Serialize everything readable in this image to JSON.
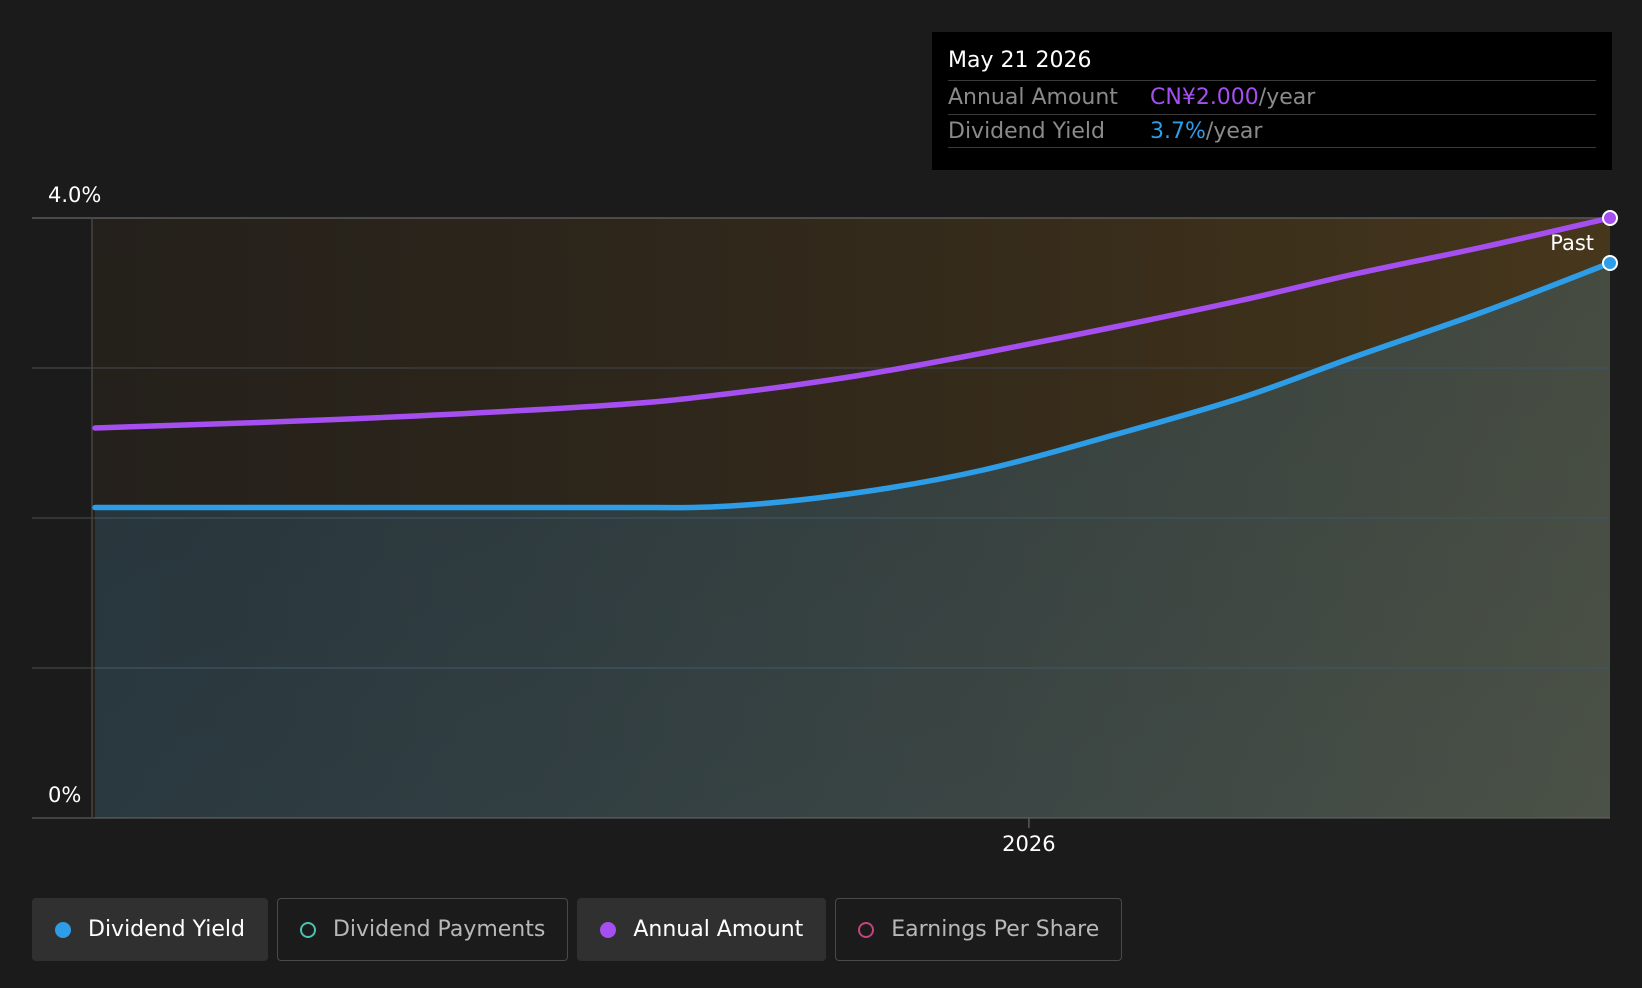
{
  "tooltip": {
    "date": "May 21 2026",
    "annual_label": "Annual Amount",
    "annual_value": "CN¥2.000",
    "annual_unit": "/year",
    "yield_label": "Dividend Yield",
    "yield_value": "3.7%",
    "yield_unit": "/year"
  },
  "past_label": "Past",
  "legend": [
    {
      "label": "Dividend Yield",
      "color": "#2d9de8",
      "active": true
    },
    {
      "label": "Dividend Payments",
      "color": "#4fc1b0",
      "active": false
    },
    {
      "label": "Annual Amount",
      "color": "#a64ff0",
      "active": true
    },
    {
      "label": "Earnings Per Share",
      "color": "#c2457e",
      "active": false
    }
  ],
  "chart_data": {
    "type": "line",
    "ylim": [
      0,
      4.0
    ],
    "y_ticks": [
      "4.0%",
      "0%"
    ],
    "x_ticks": [
      "2026"
    ],
    "x_range": [
      "2025-05-21",
      "2026-05-21"
    ],
    "series": [
      {
        "name": "Dividend Yield",
        "color": "#2d9de8",
        "area": true,
        "x": [
          "2025-05-21",
          "2025-07-21",
          "2025-09-21",
          "2025-10-21",
          "2025-11-21",
          "2025-12-21",
          "2026-01-21",
          "2026-02-21",
          "2026-03-21",
          "2026-04-21",
          "2026-05-21"
        ],
        "values": [
          2.07,
          2.07,
          2.07,
          2.08,
          2.17,
          2.32,
          2.55,
          2.8,
          3.08,
          3.38,
          3.7
        ]
      },
      {
        "name": "Annual Amount",
        "color": "#a64ff0",
        "area": false,
        "x": [
          "2025-05-21",
          "2025-07-21",
          "2025-09-21",
          "2025-10-21",
          "2025-11-21",
          "2025-12-21",
          "2026-01-21",
          "2026-02-21",
          "2026-03-21",
          "2026-04-21",
          "2026-05-21"
        ],
        "values": [
          2.6,
          2.66,
          2.75,
          2.83,
          2.95,
          3.1,
          3.27,
          3.45,
          3.63,
          3.81,
          4.0
        ]
      }
    ],
    "colors": {
      "background": "#1b1b1b",
      "grid": "#3c3c3c"
    }
  }
}
